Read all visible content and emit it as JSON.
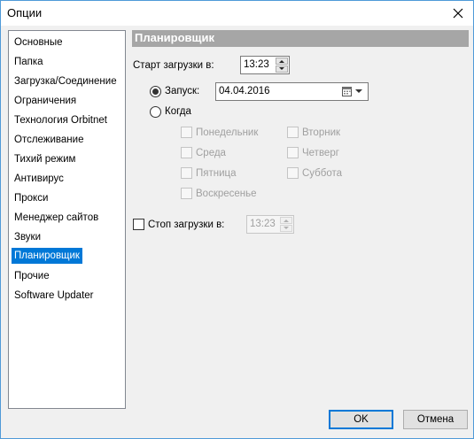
{
  "window": {
    "title": "Опции"
  },
  "nav": {
    "items": [
      {
        "label": "Основные"
      },
      {
        "label": "Папка"
      },
      {
        "label": "Загрузка/Соединение"
      },
      {
        "label": "Ограничения"
      },
      {
        "label": "Технология Orbitnet"
      },
      {
        "label": "Отслеживание"
      },
      {
        "label": "Тихий режим"
      },
      {
        "label": "Антивирус"
      },
      {
        "label": "Прокси"
      },
      {
        "label": "Менеджер сайтов"
      },
      {
        "label": "Звуки"
      },
      {
        "label": "Планировщик"
      },
      {
        "label": "Прочие"
      },
      {
        "label": "Software Updater"
      }
    ],
    "selected": "Планировщик"
  },
  "scheduler": {
    "title": "Планировщик",
    "start_label": "Старт загрузки в:",
    "start_time": "13:23",
    "launch_label": "Запуск:",
    "launch_checked": true,
    "launch_date": "04.04.2016",
    "when_label": "Когда",
    "when_checked": false,
    "days": {
      "mon": "Понедельник",
      "tue": "Вторник",
      "wed": "Среда",
      "thu": "Четверг",
      "fri": "Пятница",
      "sat": "Суббота",
      "sun": "Воскресенье"
    },
    "stop_label": "Стоп загрузки в:",
    "stop_checked": false,
    "stop_time": "13:23"
  },
  "buttons": {
    "ok": "OK",
    "cancel": "Отмена"
  },
  "icons": {
    "close": "close-icon",
    "calendar": "calendar-icon",
    "dropdown": "chevron-down-icon"
  },
  "colors": {
    "selection": "#0078d7",
    "header": "#a6a6a6",
    "window_border": "#4f9ad8"
  }
}
